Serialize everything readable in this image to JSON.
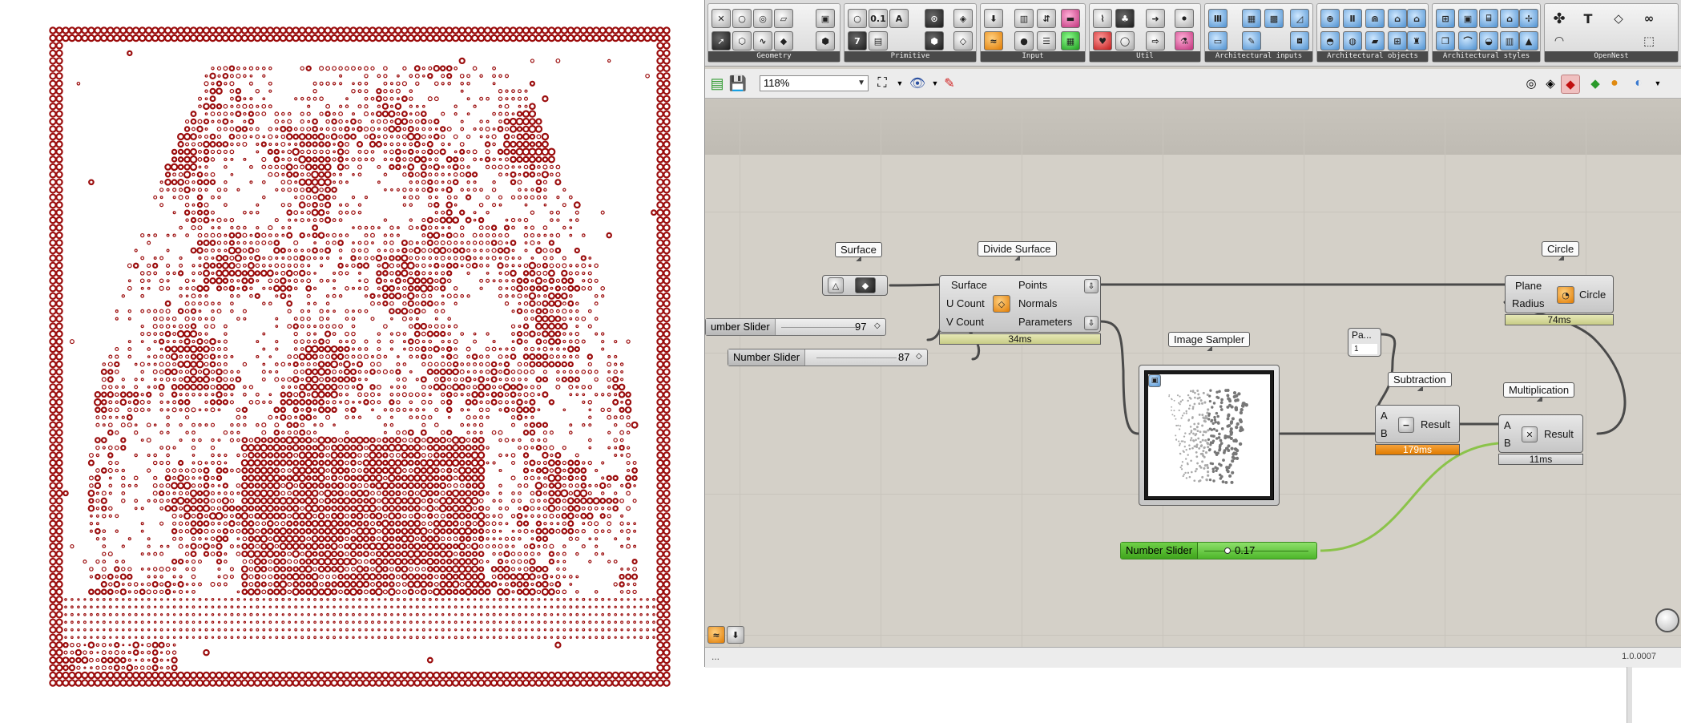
{
  "ribbon": {
    "groups": [
      {
        "label": "Geometry"
      },
      {
        "label": "Primitive"
      },
      {
        "label": "Input"
      },
      {
        "label": "Util"
      },
      {
        "label": "Architectural inputs"
      },
      {
        "label": "Architectural objects"
      },
      {
        "label": "Architectural styles"
      },
      {
        "label": "OpenNest"
      }
    ]
  },
  "toolbar": {
    "zoom": "118%"
  },
  "canvas": {
    "surface": {
      "title": "Surface"
    },
    "divide": {
      "title": "Divide Surface",
      "inputs": [
        "Surface",
        "U Count",
        "V Count"
      ],
      "outputs": [
        "Points",
        "Normals",
        "Parameters"
      ],
      "time": "34ms"
    },
    "slider_u": {
      "name": "umber Slider",
      "value": "97"
    },
    "slider_v": {
      "name": "Number Slider",
      "value": "87"
    },
    "sampler": {
      "title": "Image Sampler"
    },
    "panel": {
      "title": "Pa...",
      "value": "1"
    },
    "subtraction": {
      "title": "Subtraction",
      "inputs": [
        "A",
        "B"
      ],
      "output": "Result",
      "time": "179ms"
    },
    "multiplication": {
      "title": "Multiplication",
      "inputs": [
        "A",
        "B"
      ],
      "output": "Result",
      "time": "11ms"
    },
    "circle": {
      "title": "Circle",
      "inputs": [
        "Plane",
        "Radius"
      ],
      "output": "Circle",
      "time": "74ms"
    },
    "slider_f": {
      "name": "Number Slider",
      "value": "0.17"
    }
  },
  "status": {
    "left": "...",
    "version": "1.0.0007"
  },
  "colors": {
    "dot": "#9b0d0d",
    "slider_green": "#5ec234",
    "time_orange": "#e07b00",
    "canvas_bg": "#d4d0c8"
  }
}
